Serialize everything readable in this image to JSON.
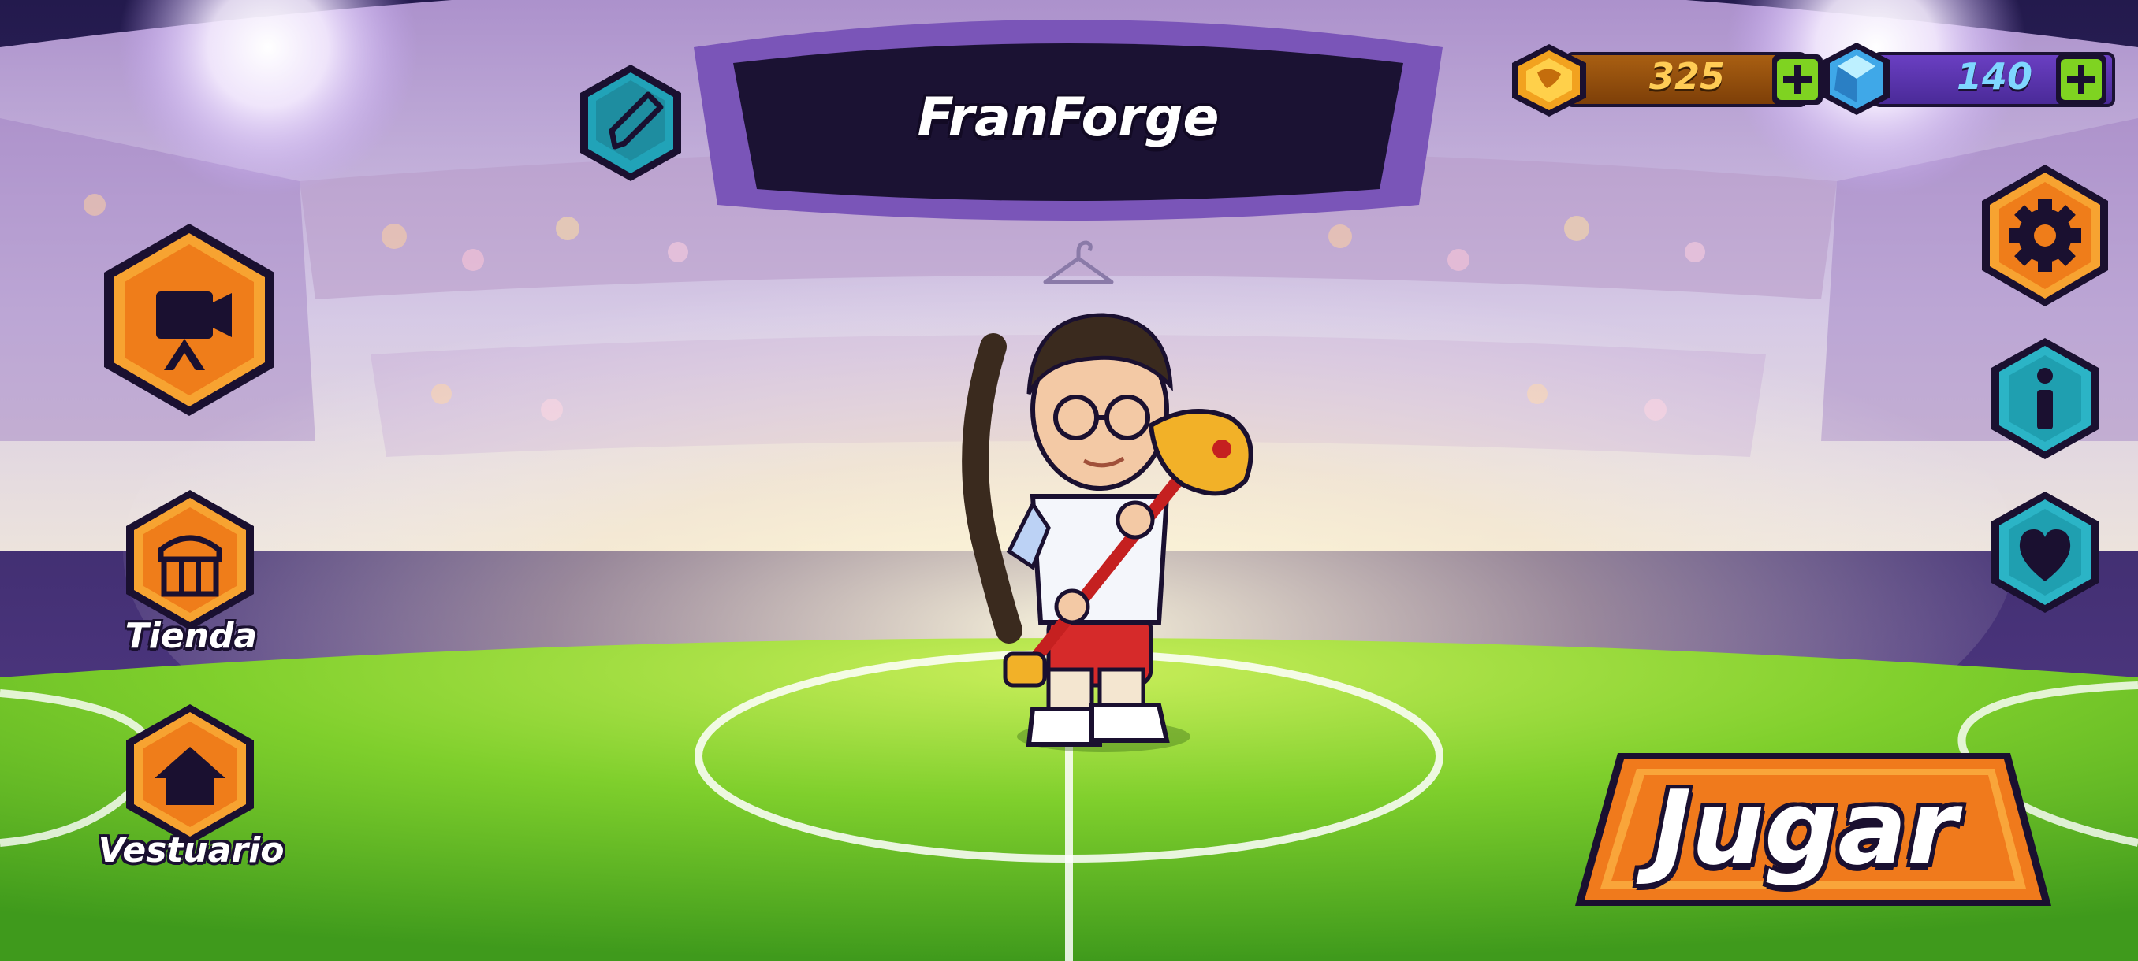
{
  "player": {
    "name": "FranForge"
  },
  "currencies": {
    "coins": {
      "value": "325",
      "icon": "gold-coin-icon",
      "color": "#f2a21f"
    },
    "gems": {
      "value": "140",
      "icon": "blue-gem-icon",
      "color": "#3fa8e8"
    }
  },
  "left_menu": {
    "video": {
      "icon": "video-camera-icon"
    },
    "shop": {
      "label": "Tienda",
      "icon": "shop-stall-icon"
    },
    "wardrobe": {
      "label": "Vestuario",
      "icon": "home-icon"
    }
  },
  "right_menu": {
    "settings": {
      "icon": "gear-icon"
    },
    "info": {
      "icon": "info-icon"
    },
    "favorites": {
      "icon": "heart-icon"
    }
  },
  "edit_name": {
    "icon": "pencil-icon"
  },
  "wardrobe_hanger": {
    "icon": "hanger-icon"
  },
  "play_button": {
    "label": "Jugar",
    "color": "#f07a1c"
  },
  "colors": {
    "orange_accent": "#f07a1c",
    "teal_accent": "#1f9fb0",
    "pitch_green": "#6fc52a",
    "plus_green": "#7fd321"
  }
}
